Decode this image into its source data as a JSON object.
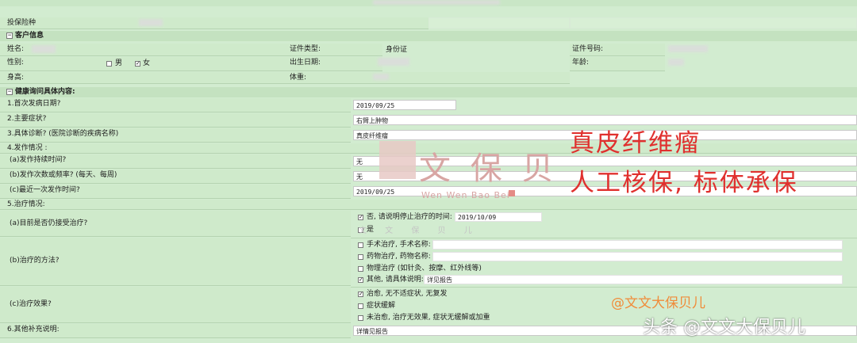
{
  "form": {
    "insurance_type_label": "投保险种",
    "section_customer": "客户信息",
    "name_label": "姓名:",
    "id_type_label": "证件类型:",
    "id_type_value": "身份证",
    "id_number_label": "证件号码:",
    "gender_label": "性别:",
    "gender_male": "男",
    "gender_female": "女",
    "birth_label": "出生日期:",
    "age_label": "年龄:",
    "height_label": "身高:",
    "weight_label": "体重:",
    "section_health": "健康询问具体内容:",
    "q1_label": "1.首次发病日期?",
    "q1_value": "2019/09/25",
    "q2_label": "2.主要症状?",
    "q2_value": "右臂上肿物",
    "q3_label": "3.具体诊断? (医院诊断的疾病名称)",
    "q3_value": "真皮纤维瘤",
    "q4_label": "4.发作情况 :",
    "q4a_label": "(a)发作持续时间?",
    "q4a_value": "无",
    "q4b_label": "(b)发作次数或频率? (每天、每周)",
    "q4b_value": "无",
    "q4c_label": "(c)最近一次发作时间?",
    "q4c_value": "2019/09/25",
    "q5_label": "5.治疗情况:",
    "q5a_label": "(a)目前是否仍接受治疗?",
    "q5a_no": "否, 请说明停止治疗的时间:",
    "q5a_no_value": "2019/10/09",
    "q5a_yes": "是",
    "q5b_label": "(b)治疗的方法?",
    "q5b_opt1": "手术治疗, 手术名称:",
    "q5b_opt2": "药物治疗, 药物名称:",
    "q5b_opt3": "物理治疗 (如针灸、按摩、红外线等)",
    "q5b_opt4": "其他, 请具体说明:",
    "q5b_opt4_value": "详见报告",
    "q5c_label": "(c)治疗效果?",
    "q5c_opt1": "治愈, 无不适症状, 无复发",
    "q5c_opt2": "症状缓解",
    "q5c_opt3": "未治愈, 治疗无效果, 症状无缓解或加重",
    "q6_label": "6.其他补充说明:",
    "q6_value": "详情见报告"
  },
  "annotations": {
    "diagnosis_title": "真皮纤维瘤",
    "result_text": "人工核保, 标体承保",
    "watermark_cn": "文 保 贝",
    "watermark_en": "Wen Wen Bao Bei",
    "watermark_scatter": "文   文   保   贝   儿",
    "handle": "@文文大保贝儿",
    "footer": "头条 @文文大保贝儿"
  },
  "colors": {
    "background": "#d2ecd0",
    "accent_red": "#e0302e"
  }
}
